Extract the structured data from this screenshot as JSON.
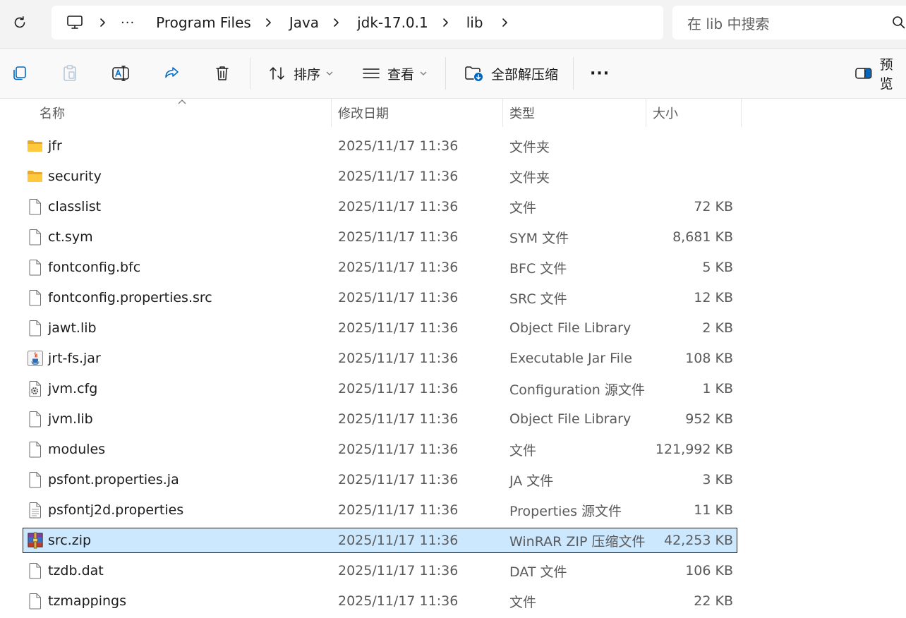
{
  "address": {
    "more_label": "···",
    "crumbs": [
      "Program Files",
      "Java",
      "jdk-17.0.1",
      "lib"
    ],
    "search_placeholder": "在 lib 中搜索"
  },
  "toolbar": {
    "sort_label": "排序",
    "view_label": "查看",
    "extract_label": "全部解压缩",
    "more_label": "···",
    "preview_label": "预览"
  },
  "columns": {
    "name": "名称",
    "date": "修改日期",
    "type": "类型",
    "size": "大小"
  },
  "files": [
    {
      "name": "jfr",
      "date": "2025/11/17 11:36",
      "type": "文件夹",
      "size": "",
      "icon": "folder-icon"
    },
    {
      "name": "security",
      "date": "2025/11/17 11:36",
      "type": "文件夹",
      "size": "",
      "icon": "folder-icon"
    },
    {
      "name": "classlist",
      "date": "2025/11/17 11:36",
      "type": "文件",
      "size": "72 KB",
      "icon": "file-icon"
    },
    {
      "name": "ct.sym",
      "date": "2025/11/17 11:36",
      "type": "SYM 文件",
      "size": "8,681 KB",
      "icon": "file-icon"
    },
    {
      "name": "fontconfig.bfc",
      "date": "2025/11/17 11:36",
      "type": "BFC 文件",
      "size": "5 KB",
      "icon": "file-icon"
    },
    {
      "name": "fontconfig.properties.src",
      "date": "2025/11/17 11:36",
      "type": "SRC 文件",
      "size": "12 KB",
      "icon": "file-icon"
    },
    {
      "name": "jawt.lib",
      "date": "2025/11/17 11:36",
      "type": "Object File Library",
      "size": "2 KB",
      "icon": "file-icon"
    },
    {
      "name": "jrt-fs.jar",
      "date": "2025/11/17 11:36",
      "type": "Executable Jar File",
      "size": "108 KB",
      "icon": "java-jar-icon"
    },
    {
      "name": "jvm.cfg",
      "date": "2025/11/17 11:36",
      "type": "Configuration 源文件",
      "size": "1 KB",
      "icon": "config-file-icon"
    },
    {
      "name": "jvm.lib",
      "date": "2025/11/17 11:36",
      "type": "Object File Library",
      "size": "952 KB",
      "icon": "file-icon"
    },
    {
      "name": "modules",
      "date": "2025/11/17 11:36",
      "type": "文件",
      "size": "121,992 KB",
      "icon": "file-icon"
    },
    {
      "name": "psfont.properties.ja",
      "date": "2025/11/17 11:36",
      "type": "JA 文件",
      "size": "3 KB",
      "icon": "file-icon"
    },
    {
      "name": "psfontj2d.properties",
      "date": "2025/11/17 11:36",
      "type": "Properties 源文件",
      "size": "11 KB",
      "icon": "text-file-icon"
    },
    {
      "name": "src.zip",
      "date": "2025/11/17 11:36",
      "type": "WinRAR ZIP 压缩文件",
      "size": "42,253 KB",
      "icon": "winrar-archive-icon",
      "selected": true
    },
    {
      "name": "tzdb.dat",
      "date": "2025/11/17 11:36",
      "type": "DAT 文件",
      "size": "106 KB",
      "icon": "file-icon"
    },
    {
      "name": "tzmappings",
      "date": "2025/11/17 11:36",
      "type": "文件",
      "size": "22 KB",
      "icon": "file-icon"
    }
  ],
  "colors": {
    "selection_bg": "#cce8ff",
    "folder_yellow": "#ffc83d",
    "accent_blue": "#0067c0"
  }
}
